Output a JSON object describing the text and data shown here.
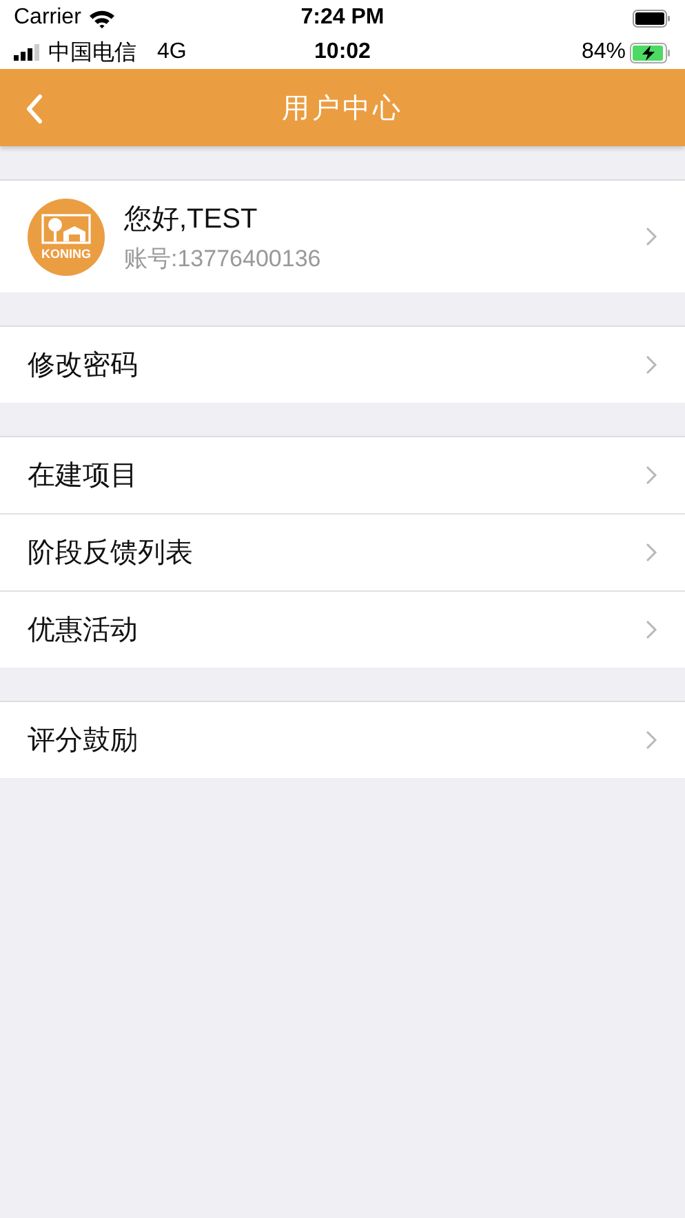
{
  "sim_status_bar": {
    "carrier": "Carrier",
    "time": "7:24 PM"
  },
  "status_bar": {
    "carrier": "中国电信",
    "network": "4G",
    "time": "10:02",
    "battery": "84%"
  },
  "nav_bar": {
    "title": "用户中心"
  },
  "profile": {
    "logo_text": "KONING",
    "greeting": "您好,TEST",
    "account": "账号:13776400136"
  },
  "groups": [
    {
      "items": [
        {
          "label": "修改密码"
        }
      ]
    },
    {
      "items": [
        {
          "label": "在建项目"
        },
        {
          "label": "阶段反馈列表"
        },
        {
          "label": "优惠活动"
        }
      ]
    },
    {
      "items": [
        {
          "label": "评分鼓励"
        }
      ]
    }
  ]
}
